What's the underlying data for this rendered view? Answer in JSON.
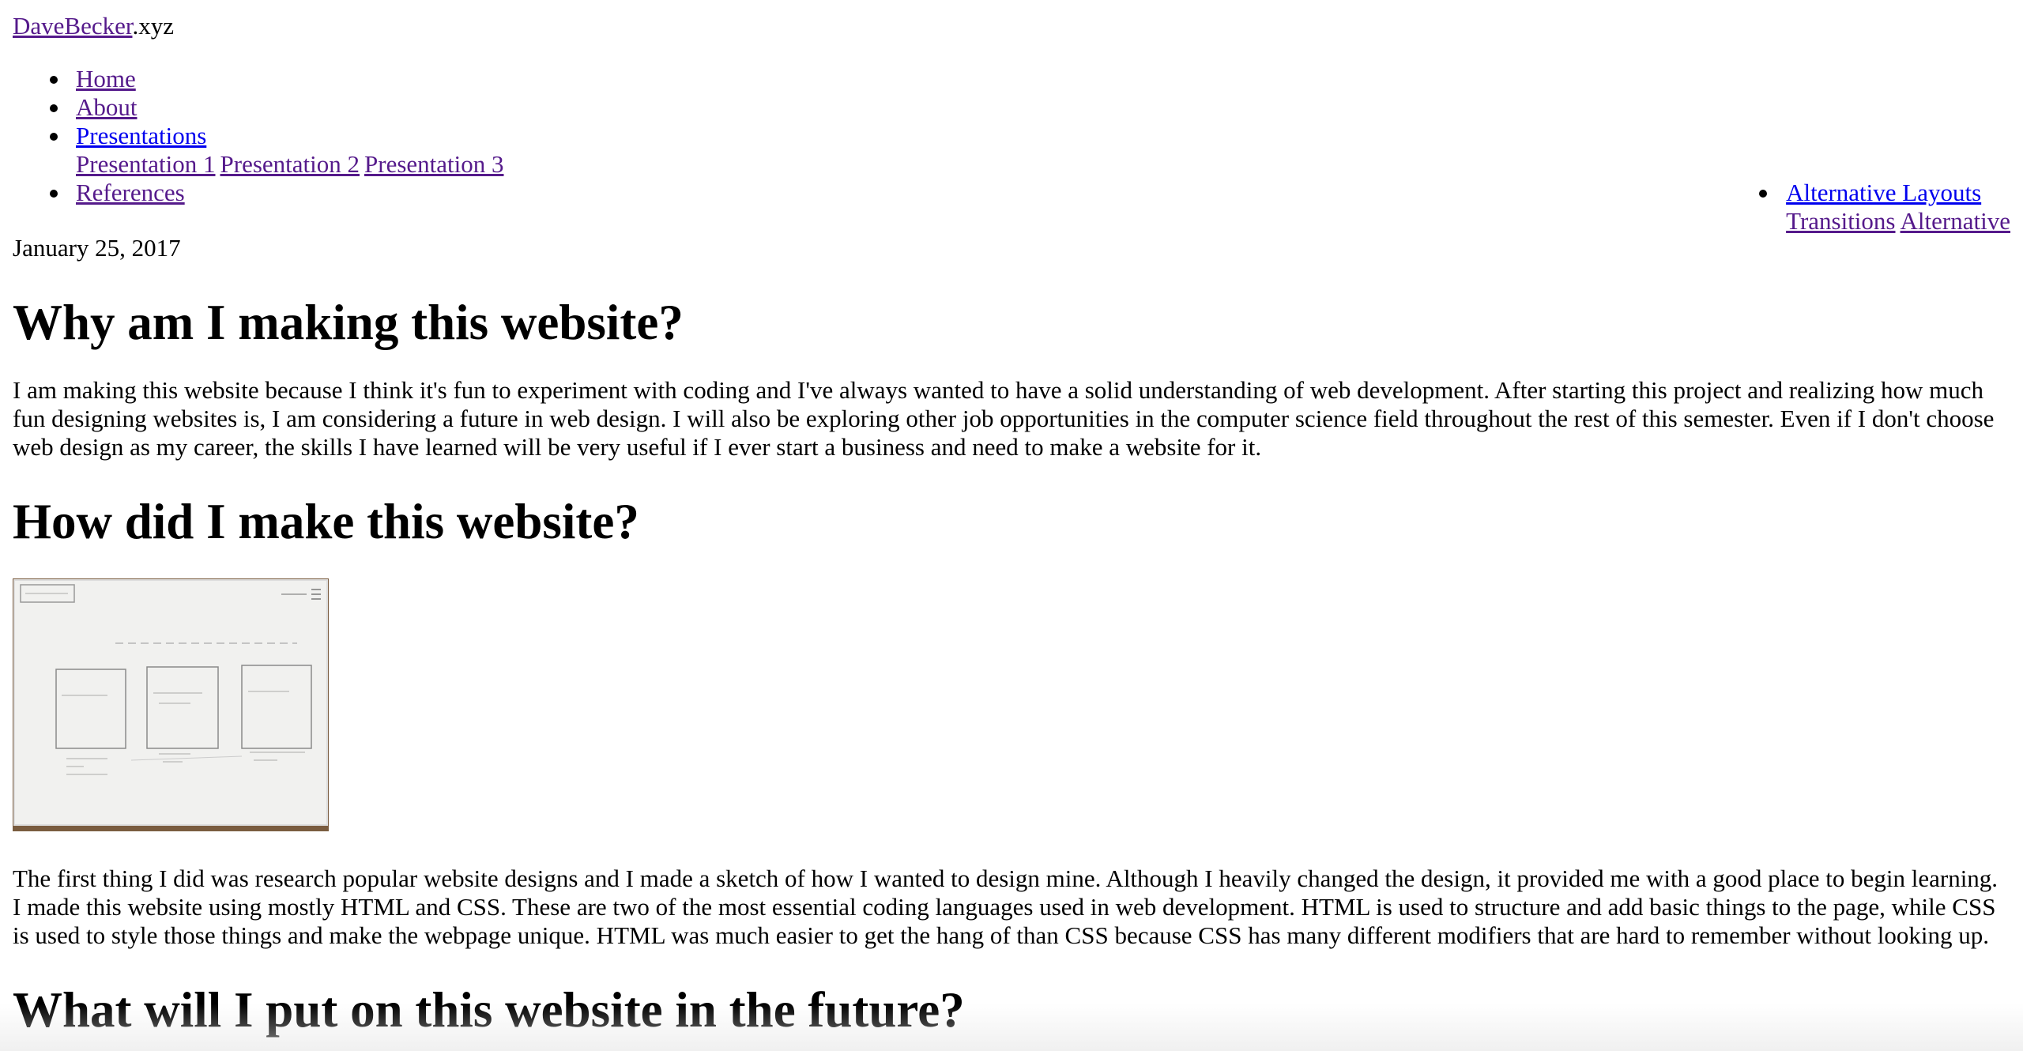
{
  "header": {
    "site_link": "DaveBecker",
    "site_suffix": ".xyz"
  },
  "nav": {
    "home": "Home",
    "about": "About",
    "presentations": "Presentations",
    "presentation_1": "Presentation 1",
    "presentation_2": "Presentation 2",
    "presentation_3": "Presentation 3",
    "references": "References"
  },
  "alt_nav": {
    "alternative_layouts": "Alternative Layouts",
    "transitions": "Transitions",
    "alternative": "Alternative"
  },
  "article": {
    "date": "January 25, 2017",
    "heading_1": "Why am I making this website?",
    "paragraph_1": "I am making this website because I think it's fun to experiment with coding and I've always wanted to have a solid understanding of web development. After starting this project and realizing how much fun designing websites is, I am considering a future in web design. I will also be exploring other job opportunities in the computer science field throughout the rest of this semester. Even if I don't choose web design as my career, the skills I have learned will be very useful if I ever start a business and need to make a website for it.",
    "heading_2": "How did I make this website?",
    "paragraph_2": "The first thing I did was research popular website designs and I made a sketch of how I wanted to design mine. Although I heavily changed the design, it provided me with a good place to begin learning. I made this website using mostly HTML and CSS. These are two of the most essential coding languages used in web development. HTML is used to structure and add basic things to the page, while CSS is used to style those things and make the webpage unique. HTML was much easier to get the hang of than CSS because CSS has many different modifiers that are hard to remember without looking up.",
    "heading_3": "What will I put on this website in the future?"
  },
  "colors": {
    "visited_link": "#551a8b",
    "unvisited_link": "#0000ee",
    "text": "#000000",
    "background": "#ffffff"
  }
}
